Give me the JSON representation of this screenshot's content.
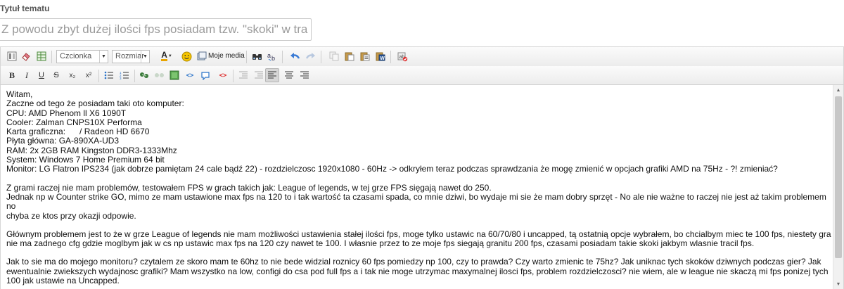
{
  "topic": {
    "label": "Tytuł tematu",
    "value": "Z powodu zbyt dużej ilości fps posiadam tzw. \"skoki\" w trakcie g"
  },
  "toolbar": {
    "font_combo": "Czcionka",
    "size_combo": "Rozmiar",
    "media_label": "Moje media",
    "row1_icons": [
      "source-icon",
      "eraser-icon",
      "table-icon",
      "font-color-icon",
      "smiley-icon",
      "media-icon",
      "find-icon",
      "replace-icon",
      "undo-icon",
      "redo-icon",
      "copy-icon",
      "paste-icon",
      "paste-text-icon",
      "paste-word-icon",
      "spellcheck-icon"
    ],
    "row2_icons": [
      "bold-icon",
      "italic-icon",
      "underline-icon",
      "strikethrough-icon",
      "subscript-icon",
      "superscript-icon",
      "bullet-list-icon",
      "numbered-list-icon",
      "link-icon",
      "unlink-icon",
      "image-icon",
      "code-icon",
      "quote-icon",
      "youtube-icon",
      "outdent-icon",
      "indent-icon",
      "align-left-icon",
      "align-center-icon",
      "align-right-icon"
    ],
    "glyphs": {
      "bold": "B",
      "italic": "I",
      "underline": "U",
      "strike": "S",
      "sub": "x₂",
      "sup": "x²",
      "code": "<>",
      "youtube": "<>",
      "font_color": "A"
    }
  },
  "editor": {
    "lines": [
      "Witam,",
      "Zaczne od tego że posiadam taki oto komputer:",
      "CPU: AMD Phenom ll X6 1090T",
      "Cooler: Zalman CNPS10X Performa",
      "Karta graficzna:      / Radeon HD 6670",
      "Płyta główna: GA-890XA-UD3",
      "RAM: 2x 2GB RAM Kingston DDR3-1333Mhz",
      "System: Windows 7 Home Premium 64 bit",
      "Monitor: LG Flatron IPS234 (jak dobrze pamiętam 24 cale bądź 22) - rozdzielczosc 1920x1080 - 60Hz -> odkryłem teraz podczas sprawdzania że mogę zmienić w opcjach grafiki AMD na 75Hz - ?! zmieniać?",
      "",
      "Z grami raczej nie mam problemów, testowałem FPS w grach takich jak: League of legends, w tej grze FPS sięgają nawet do 250.",
      "Jednak np w Counter strike GO, mimo ze mam ustawione max fps na 120 to i tak wartość ta czasami spada, co mnie dziwi, bo wydaje mi sie że mam dobry sprzęt - No ale nie ważne to raczej nie jest aż takim problemem no",
      "chyba ze ktos przy okazji odpowie.",
      "",
      "Głównym problemem jest to że w grze League of legends nie mam możliwości ustawienia stałej ilości fps, moge tylko ustawic na 60/70/80 i uncapped, tą ostatnią opcje wybrałem, bo chcialbym miec te 100 fps, niestety gra",
      "nie ma zadnego cfg gdzie moglbym jak w cs np ustawic max fps na 120 czy nawet te 100. I własnie przez to ze moje fps siegają granitu 200 fps, czasami posiadam takie skoki jakbym wlasnie tracil fps.",
      "",
      "Jak to sie ma do mojego monitoru? czytalem ze skoro mam te 60hz to nie bede widzial roznicy 60 fps pomiedzy np 100, czy to prawda? Czy warto zmienic te 75hz? Jak uniknac tych skoków dziwnych podczas gier? Jak",
      "ewentualnie zwiekszych wydajnosc grafiki? Mam wszystko na low, configi do csa pod full fps a i tak nie moge utrzymac maxymalnej ilosci fps, problem rozdzielczosci? nie wiem, ale w league nie skaczą mi fps ponizej tych",
      "100 jak ustawie na Uncapped."
    ]
  }
}
